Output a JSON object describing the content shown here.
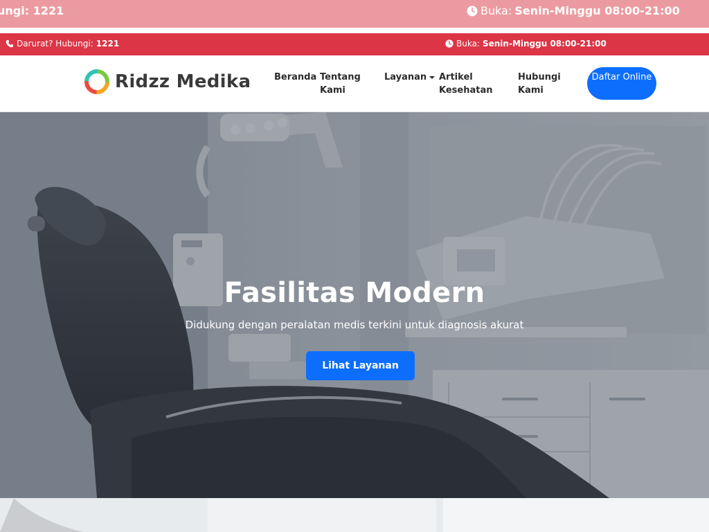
{
  "ghost_bar": {
    "left_text": "ungi: ",
    "left_number": "1221",
    "right_label": "Buka: ",
    "right_value": "Senin-Minggu 08:00-21:00"
  },
  "top_bar": {
    "emergency_label": "Darurat? Hubungi: ",
    "emergency_number": "1221",
    "hours_label": "Buka: ",
    "hours_value": "Senin-Minggu 08:00-21:00"
  },
  "navbar": {
    "brand": "Ridzz Medika",
    "items": [
      {
        "label": "Beranda"
      },
      {
        "label": "Tentang Kami"
      },
      {
        "label": "Layanan"
      },
      {
        "label": "Artikel Kesehatan"
      },
      {
        "label": "Hubungi Kami"
      }
    ],
    "cta": "Daftar Online"
  },
  "hero": {
    "title": "Fasilitas Modern",
    "subtitle": "Didukung dengan peralatan medis terkini untuk diagnosis akurat",
    "button": "Lihat Layanan"
  },
  "colors": {
    "emergency_red": "#dc3545",
    "ghost_red": "#ec9aa1",
    "primary_blue": "#0d6efd"
  },
  "icons": [
    "phone-icon",
    "clock-icon",
    "logo-ring-icon",
    "chevron-down-icon"
  ]
}
